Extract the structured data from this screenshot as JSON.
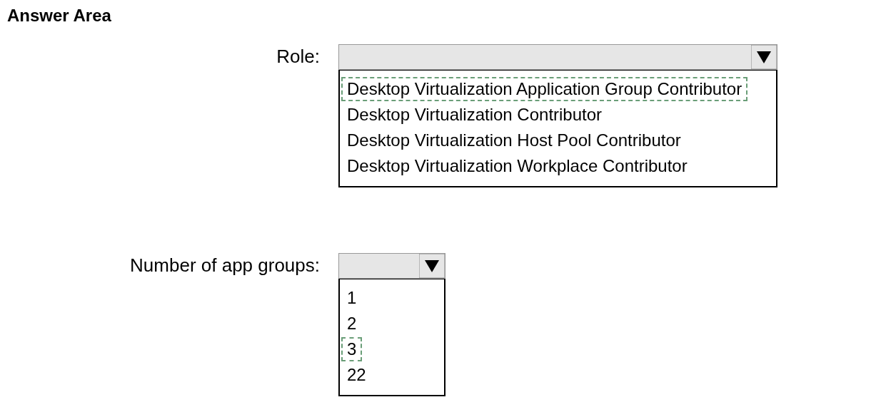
{
  "title": "Answer Area",
  "questions": [
    {
      "label": "Role:",
      "options": [
        {
          "text": "Desktop Virtualization Application Group Contributor",
          "selected": true
        },
        {
          "text": "Desktop Virtualization Contributor",
          "selected": false
        },
        {
          "text": "Desktop Virtualization Host Pool Contributor",
          "selected": false
        },
        {
          "text": "Desktop Virtualization Workplace Contributor",
          "selected": false
        }
      ]
    },
    {
      "label": "Number of app groups:",
      "options": [
        {
          "text": "1",
          "selected": false
        },
        {
          "text": "2",
          "selected": false
        },
        {
          "text": "3",
          "selected": true
        },
        {
          "text": "22",
          "selected": false
        }
      ]
    }
  ]
}
